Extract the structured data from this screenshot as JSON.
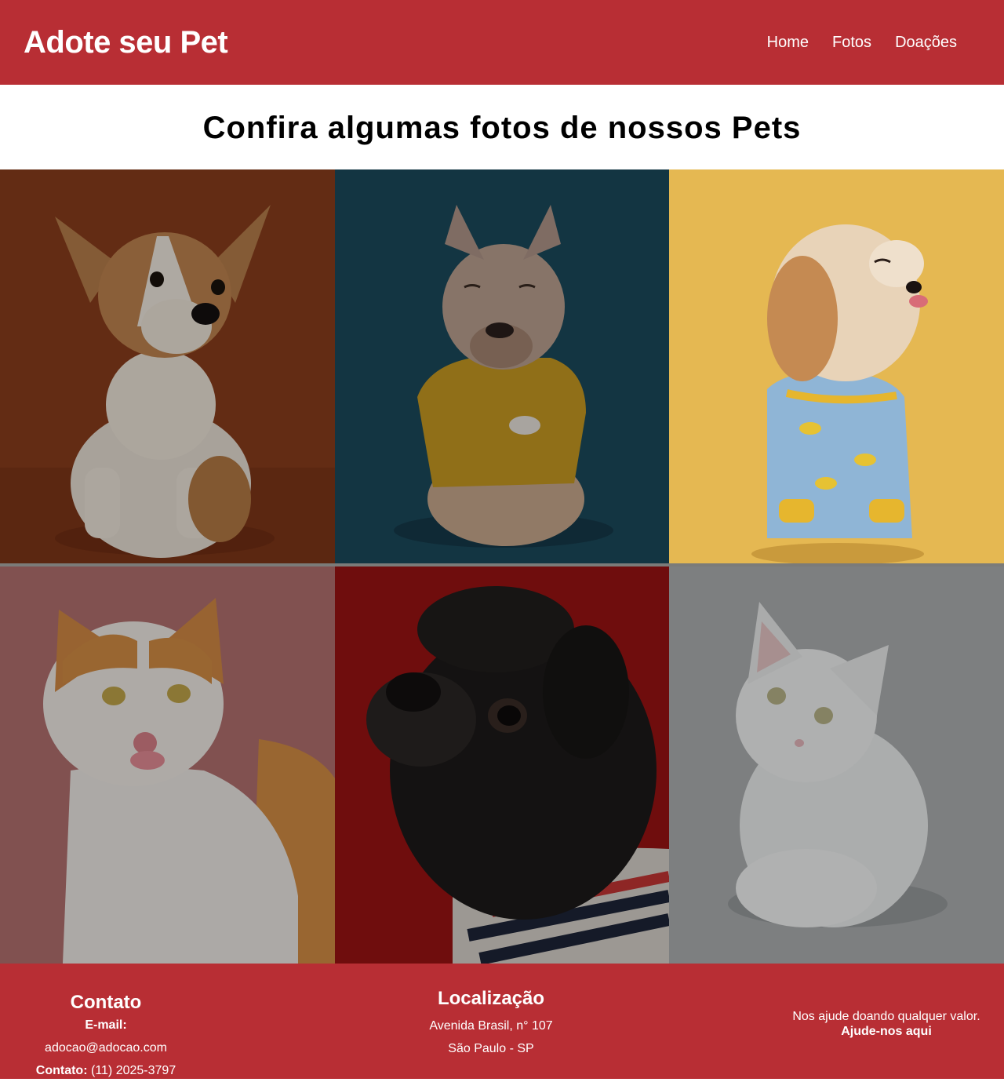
{
  "header": {
    "brand": "Adote seu Pet",
    "nav": [
      "Home",
      "Fotos",
      "Doações"
    ]
  },
  "main": {
    "title": "Confira algumas fotos de nossos Pets",
    "photos": [
      {
        "subject": "corgi puppy",
        "background_color": "#8a3d1c"
      },
      {
        "subject": "french bulldog in yellow sweater",
        "background_color": "#1b4a5c"
      },
      {
        "subject": "shih tzu in banana pajamas",
        "background_color": "#e5b852"
      },
      {
        "subject": "orange and white cat licking lips",
        "background_color": "#8a5555"
      },
      {
        "subject": "black pug in striped shirt",
        "background_color": "#6e0b0b"
      },
      {
        "subject": "white cat",
        "background_color": "#7c7d7e"
      }
    ]
  },
  "footer": {
    "contact": {
      "title": "Contato",
      "email_label": "E-mail:",
      "email": "adocao@adocao.com",
      "phone_label": "Contato:",
      "phone": "(11) 2025-3797"
    },
    "location": {
      "title": "Localização",
      "address": "Avenida Brasil, n° 107",
      "city": "São Paulo - SP"
    },
    "donate": {
      "text": "Nos ajude doando qualquer valor.",
      "link": "Ajude-nos aqui"
    }
  },
  "colors": {
    "brand_red": "#b82e34",
    "white": "#ffffff"
  }
}
